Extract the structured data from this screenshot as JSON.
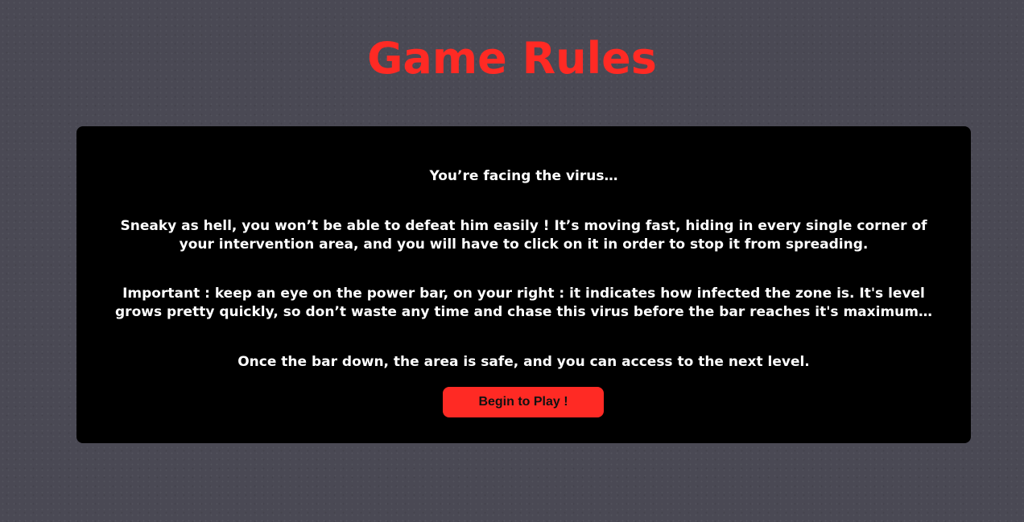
{
  "page": {
    "title": "Game Rules"
  },
  "rules": {
    "intro": "You’re facing the virus…",
    "description": "Sneaky as hell, you won’t be able to defeat him easily ! It’s moving fast, hiding in every single corner of your intervention area, and you will have to click on it in order to stop it from spreading.",
    "important": "Important : keep an eye on the power bar, on your right : it indicates how infected the zone is. It's level grows pretty quickly, so don’t waste any time and chase this virus before the bar reaches it's maximum…",
    "outcome": "Once the bar down, the area is safe, and you can access to the next level."
  },
  "actions": {
    "start_label": "Begin to Play !"
  },
  "colors": {
    "background": "#4a4954",
    "accent": "#ff2a24",
    "panel": "#000000",
    "text": "#ffffff"
  }
}
